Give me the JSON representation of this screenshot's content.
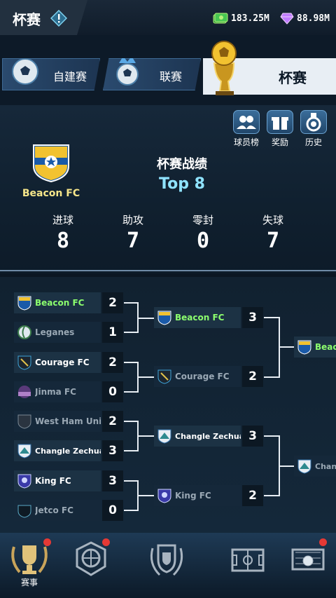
{
  "header": {
    "title": "杯赛",
    "coins": "183.25M",
    "gems": "88.98M"
  },
  "tabs": [
    {
      "label": "自建赛"
    },
    {
      "label": "联赛"
    },
    {
      "label": "杯赛"
    }
  ],
  "actions": [
    {
      "label": "球员榜"
    },
    {
      "label": "奖励"
    },
    {
      "label": "历史"
    }
  ],
  "club": {
    "name": "Beacon FC"
  },
  "record": {
    "title": "杯赛战绩",
    "rank": "Top 8"
  },
  "stats": [
    {
      "label": "进球",
      "value": "8"
    },
    {
      "label": "助攻",
      "value": "7"
    },
    {
      "label": "零封",
      "value": "0"
    },
    {
      "label": "失球",
      "value": "7"
    }
  ],
  "round1": [
    {
      "name": "Beacon FC",
      "score": "2",
      "winner": true
    },
    {
      "name": "Leganes",
      "score": "1",
      "winner": false
    },
    {
      "name": "Courage FC",
      "score": "2",
      "winner": true
    },
    {
      "name": "Jinma FC",
      "score": "0",
      "winner": false
    },
    {
      "name": "West Ham United",
      "score": "2",
      "winner": false
    },
    {
      "name": "Changle Zechuan FC",
      "score": "3",
      "winner": true
    },
    {
      "name": "King FC",
      "score": "3",
      "winner": true
    },
    {
      "name": "Jetco FC",
      "score": "0",
      "winner": false
    }
  ],
  "round2": [
    {
      "name": "Beacon FC",
      "score": "3"
    },
    {
      "name": "Courage FC",
      "score": "2"
    },
    {
      "name": "Changle Zechuan FC",
      "score": "3"
    },
    {
      "name": "King FC",
      "score": "2"
    }
  ],
  "round3": [
    {
      "name": "Beaco"
    },
    {
      "name": "Changl"
    }
  ],
  "nav": [
    {
      "label": "赛事"
    }
  ]
}
